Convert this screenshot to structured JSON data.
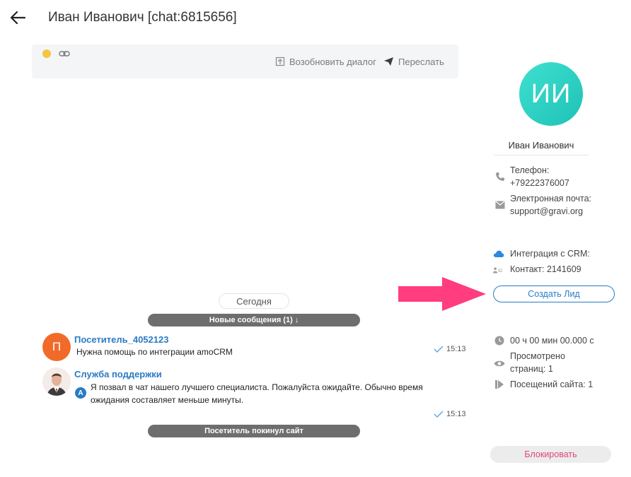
{
  "header": {
    "title": "Иван Иванович [chat:6815656]"
  },
  "icons": {
    "back": "arrow-left-icon",
    "link": "link-icon",
    "resume": "archive-icon",
    "forward": "send-icon",
    "phone": "phone-icon",
    "email": "email-icon",
    "cloud": "cloud-icon",
    "id": "id-icon",
    "clock": "clock-icon",
    "eye": "eye-icon",
    "visits": "visits-icon"
  },
  "toolbar": {
    "resume_label": "Возобновить диалог",
    "forward_label": "Переслать"
  },
  "chat": {
    "today_label": "Сегодня",
    "new_messages_label": "Новые сообщения (1) ↓",
    "visitor_left_label": "Посетитель покинул сайт",
    "messages": [
      {
        "avatar_letter": "П",
        "author": "Посетитель_4052123",
        "text": "Нужна помощь по интеграции amoCRM",
        "time": "15:13"
      },
      {
        "author": "Служба поддержки",
        "badge": "A",
        "text_line1": "Я позвал в чат нашего лучшего специалиста. Пожалуйста ожидайте. Обычно время",
        "text_line2": "ожидания составляет меньше минуты.",
        "time": "15:13"
      }
    ]
  },
  "contact": {
    "initials": "ИИ",
    "name": "Иван Иванович",
    "phone_label": "Телефон:",
    "phone_value": "+79222376007",
    "email_label": "Электронная почта:",
    "email_value": "support@gravi.org",
    "crm_label": "Интеграция с CRM:",
    "contact_id": "Контакт: 2141609",
    "create_lead_label": "Создать Лид",
    "duration": "00 ч 00 мин 00.000 с",
    "pages_line1": "Просмотрено",
    "pages_line2": "страниц: 1",
    "visits": "Посещений сайта: 1",
    "block_label": "Блокировать"
  },
  "colors": {
    "accent_blue": "#2a7bc4",
    "visitor_avatar": "#f26a2a",
    "contact_avatar": "#2fd3c6",
    "status_dot": "#f4c542",
    "block_text": "#e0457b",
    "annotation_arrow": "#ff3d7f"
  }
}
